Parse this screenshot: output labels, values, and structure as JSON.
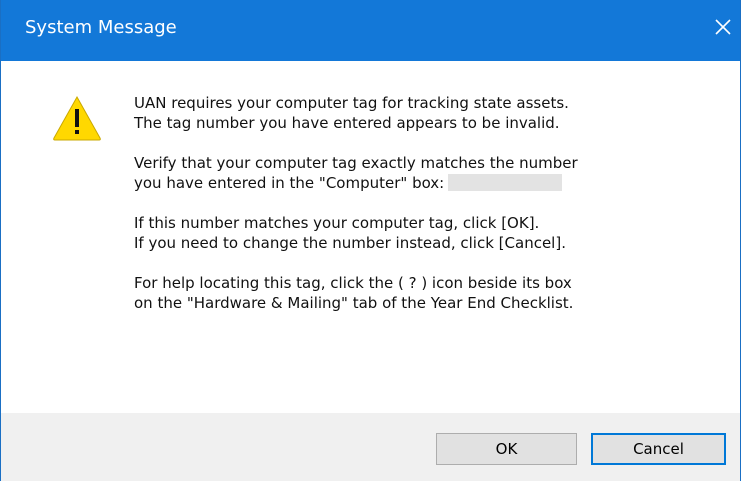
{
  "window": {
    "title": "System Message",
    "close_glyph": "✕",
    "accent_color": "#1378d8"
  },
  "icon": {
    "name": "warning-icon",
    "color": "#ffd800"
  },
  "message": {
    "p1": [
      "UAN requires your computer tag for tracking state assets.",
      "The tag number you have entered appears to be invalid."
    ],
    "p2": [
      "Verify that your computer tag exactly matches the number",
      "you have entered in the \"Computer\" box:"
    ],
    "p3": [
      "If this number matches your computer tag, click [OK].",
      "If you need to change the number instead, click [Cancel]."
    ],
    "p4": [
      "For help locating this tag, click the ( ? ) icon beside its box",
      "on the \"Hardware & Mailing\" tab of the Year End Checklist."
    ]
  },
  "buttons": {
    "ok_label": "OK",
    "cancel_label": "Cancel"
  }
}
